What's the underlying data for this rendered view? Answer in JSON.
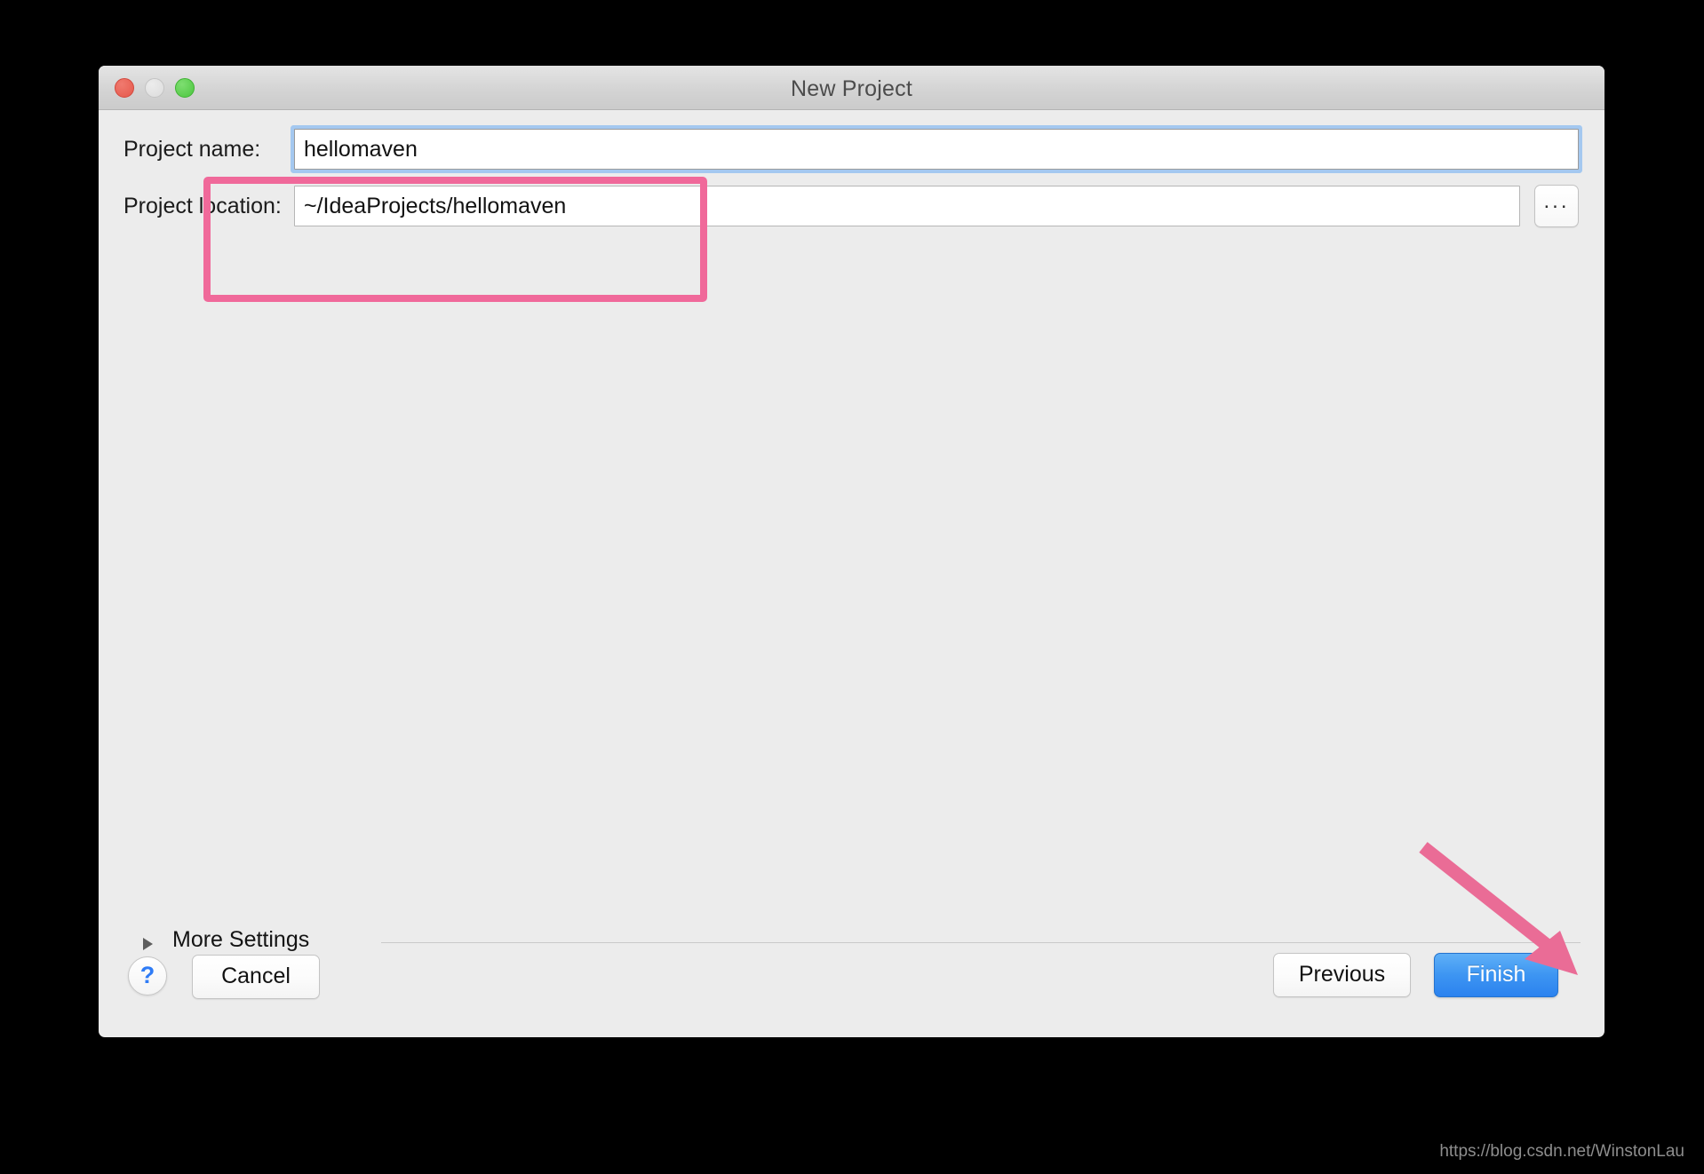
{
  "window": {
    "title": "New Project",
    "controls": {
      "close": "close-traffic-light",
      "minimize": "minimize-traffic-light",
      "maximize": "maximize-traffic-light"
    }
  },
  "form": {
    "project_name": {
      "label": "Project name:",
      "value": "hellomaven",
      "placeholder": "",
      "focused": true
    },
    "project_location": {
      "label": "Project location:",
      "value": "~/IdeaProjects/hellomaven",
      "placeholder": "",
      "focused": false
    },
    "browse_button_label": "..."
  },
  "more_settings": {
    "label": "More Settings",
    "expanded": false
  },
  "buttons": {
    "help": "?",
    "cancel": "Cancel",
    "previous": "Previous",
    "finish": "Finish"
  },
  "annotations": {
    "highlight_color": "#f0699a",
    "arrow_color": "#ea6c96",
    "highlight_target": "project name and location fields",
    "arrow_target": "Finish button"
  },
  "watermark": {
    "text": "https://blog.csdn.net/WinstonLau"
  },
  "colors": {
    "dialog_background": "#ececec",
    "titlebar_background": "#d4d4d4",
    "focus_ring": "#a4c8f0",
    "primary_button": "#3d95f2",
    "help_glyph": "#2f7cf6",
    "traffic_close": "#e5584b",
    "traffic_minimize": "#dcdcdc",
    "traffic_maximize": "#4cc63f"
  }
}
